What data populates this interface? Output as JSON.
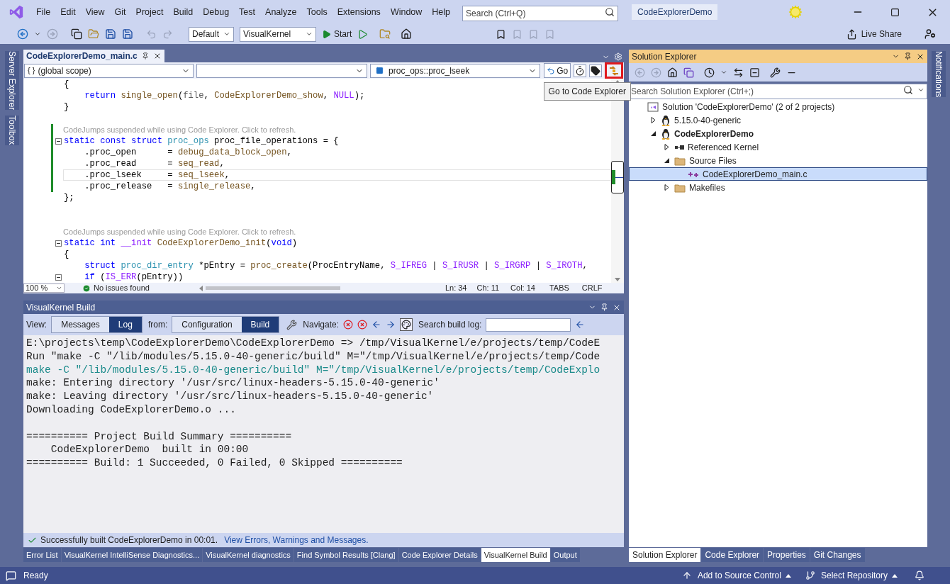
{
  "title_bar": {
    "menus": [
      "File",
      "Edit",
      "View",
      "Git",
      "Project",
      "Build",
      "Debug",
      "Test",
      "Analyze",
      "Tools",
      "Extensions",
      "Window",
      "Help"
    ],
    "search": {
      "placeholder": "Search (Ctrl+Q)"
    },
    "solution_name": "CodeExplorerDemo"
  },
  "toolbar": {
    "configuration": "Default",
    "platform": "VisualKernel",
    "start": "Start",
    "live_share": "Live Share"
  },
  "side_tabs_left": [
    "Server Explorer",
    "Toolbox"
  ],
  "side_tabs_right": [
    "Notifications"
  ],
  "editor": {
    "tab": "CodeExplorerDemo_main.c",
    "scope_glyph": "{ }",
    "scope": "(global scope)",
    "member": "proc_ops::proc_lseek",
    "go": "Go",
    "code_explorer_highlighted": true,
    "tooltip": "Go to Code Explorer",
    "lines": [
      {
        "kind": "code",
        "changed": false,
        "current": false,
        "fold": false,
        "indented": false,
        "tokens": [
          {
            "kind": "plain",
            "text": "{"
          }
        ]
      },
      {
        "kind": "code",
        "changed": false,
        "current": false,
        "fold": false,
        "indented": true,
        "tokens": [
          {
            "kind": "kw",
            "text": "return "
          },
          {
            "kind": "func",
            "text": "single_open"
          },
          {
            "kind": "plain",
            "text": "("
          },
          {
            "kind": "param",
            "text": "file"
          },
          {
            "kind": "plain",
            "text": ", "
          },
          {
            "kind": "func",
            "text": "CodeExplorerDemo_show"
          },
          {
            "kind": "plain",
            "text": ", "
          },
          {
            "kind": "macro",
            "text": "NULL"
          },
          {
            "kind": "plain",
            "text": ");"
          }
        ]
      },
      {
        "kind": "code",
        "changed": false,
        "current": false,
        "fold": false,
        "indented": false,
        "tokens": [
          {
            "kind": "plain",
            "text": "}"
          }
        ]
      },
      {
        "kind": "blank",
        "changed": false
      },
      {
        "kind": "hint",
        "changed": true,
        "text": "CodeJumps suspended while using Code Explorer. Click to refresh."
      },
      {
        "kind": "code",
        "changed": true,
        "current": false,
        "fold": true,
        "indented": false,
        "tokens": [
          {
            "kind": "kw",
            "text": "static const struct "
          },
          {
            "kind": "type",
            "text": "proc_ops"
          },
          {
            "kind": "plain",
            "text": " proc_file_operations = {"
          }
        ]
      },
      {
        "kind": "code",
        "changed": true,
        "current": false,
        "fold": false,
        "indented": true,
        "tokens": [
          {
            "kind": "plain",
            "text": ".proc_open      = "
          },
          {
            "kind": "func",
            "text": "debug_data_block_open"
          },
          {
            "kind": "plain",
            "text": ","
          }
        ]
      },
      {
        "kind": "code",
        "changed": true,
        "current": false,
        "fold": false,
        "indented": true,
        "tokens": [
          {
            "kind": "plain",
            "text": ".proc_read      = "
          },
          {
            "kind": "func",
            "text": "seq_read"
          },
          {
            "kind": "plain",
            "text": ","
          }
        ]
      },
      {
        "kind": "code",
        "changed": true,
        "current": true,
        "fold": false,
        "indented": true,
        "tokens": [
          {
            "kind": "plain",
            "text": ".proc_lseek     = "
          },
          {
            "kind": "func",
            "text": "seq_lseek"
          },
          {
            "kind": "plain",
            "text": ","
          }
        ]
      },
      {
        "kind": "code",
        "changed": true,
        "current": false,
        "fold": false,
        "indented": true,
        "tokens": [
          {
            "kind": "plain",
            "text": ".proc_release   = "
          },
          {
            "kind": "func",
            "text": "single_release"
          },
          {
            "kind": "plain",
            "text": ","
          }
        ]
      },
      {
        "kind": "code",
        "changed": false,
        "current": false,
        "fold": false,
        "indented": false,
        "tokens": [
          {
            "kind": "plain",
            "text": "};"
          }
        ]
      },
      {
        "kind": "blank",
        "changed": false
      },
      {
        "kind": "blank",
        "changed": false
      },
      {
        "kind": "hint",
        "changed": false,
        "text": "CodeJumps suspended while using Code Explorer. Click to refresh."
      },
      {
        "kind": "code",
        "changed": false,
        "current": false,
        "fold": true,
        "indented": false,
        "tokens": [
          {
            "kind": "kw",
            "text": "static int "
          },
          {
            "kind": "macro",
            "text": "__init "
          },
          {
            "kind": "func",
            "text": "CodeExplorerDemo_init"
          },
          {
            "kind": "plain",
            "text": "("
          },
          {
            "kind": "kw",
            "text": "void"
          },
          {
            "kind": "plain",
            "text": ")"
          }
        ]
      },
      {
        "kind": "code",
        "changed": false,
        "current": false,
        "fold": false,
        "indented": false,
        "tokens": [
          {
            "kind": "plain",
            "text": "{"
          }
        ]
      },
      {
        "kind": "code",
        "changed": false,
        "current": false,
        "fold": false,
        "indented": true,
        "tokens": [
          {
            "kind": "kw",
            "text": "struct "
          },
          {
            "kind": "type",
            "text": "proc_dir_entry"
          },
          {
            "kind": "plain",
            "text": " *pEntry = "
          },
          {
            "kind": "func",
            "text": "proc_create"
          },
          {
            "kind": "plain",
            "text": "(ProcEntryName, "
          },
          {
            "kind": "macro",
            "text": "S_IFREG"
          },
          {
            "kind": "plain",
            "text": " | "
          },
          {
            "kind": "macro",
            "text": "S_IRUSR"
          },
          {
            "kind": "plain",
            "text": " | "
          },
          {
            "kind": "macro",
            "text": "S_IRGRP"
          },
          {
            "kind": "plain",
            "text": " | "
          },
          {
            "kind": "macro",
            "text": "S_IROTH"
          },
          {
            "kind": "plain",
            "text": ","
          }
        ]
      },
      {
        "kind": "code",
        "changed": false,
        "current": false,
        "fold": true,
        "indented": true,
        "tokens": [
          {
            "kind": "kw",
            "text": "if"
          },
          {
            "kind": "plain",
            "text": " ("
          },
          {
            "kind": "macro",
            "text": "IS_ERR"
          },
          {
            "kind": "plain",
            "text": "(pEntry))"
          }
        ]
      }
    ],
    "status": {
      "zoom": "100 %",
      "issues": "No issues found",
      "ln": "Ln: 34",
      "ch": "Ch: 11",
      "col": "Col: 14",
      "indent": "TABS",
      "eol": "CRLF"
    }
  },
  "build_panel": {
    "title": "VisualKernel Build",
    "view_label": "View:",
    "views": [
      {
        "label": "Messages",
        "selected": false
      },
      {
        "label": "Log",
        "selected": true
      }
    ],
    "from_label": "from:",
    "sources": [
      {
        "label": "Configuration",
        "selected": false
      },
      {
        "label": "Build",
        "selected": true
      }
    ],
    "navigate_label": "Navigate:",
    "search_label": "Search build log:",
    "log": [
      {
        "kind": "output",
        "text": "E:\\projects\\temp\\CodeExplorerDemo\\CodeExplorerDemo => /tmp/VisualKernel/e/projects/temp/CodeE"
      },
      {
        "kind": "output",
        "text": "Run \"make -C \"/lib/modules/5.15.0-40-generic/build\" M=\"/tmp/VisualKernel/e/projects/temp/Code"
      },
      {
        "kind": "command",
        "text": "make -C \"/lib/modules/5.15.0-40-generic/build\" M=\"/tmp/VisualKernel/e/projects/temp/CodeExplo"
      },
      {
        "kind": "output",
        "text": "make: Entering directory '/usr/src/linux-headers-5.15.0-40-generic'"
      },
      {
        "kind": "output",
        "text": "make: Leaving directory '/usr/src/linux-headers-5.15.0-40-generic'"
      },
      {
        "kind": "output",
        "text": "Downloading CodeExplorerDemo.o ..."
      },
      {
        "kind": "blank"
      },
      {
        "kind": "output",
        "text": "========== Project Build Summary =========="
      },
      {
        "kind": "output",
        "text": "    CodeExplorerDemo  built in 00:00"
      },
      {
        "kind": "output",
        "text": "========== Build: 1 Succeeded, 0 Failed, 0 Skipped =========="
      }
    ],
    "result": "Successfully built CodeExplorerDemo in 00:01.",
    "result_link": "View Errors, Warnings and Messages.",
    "tabs": [
      {
        "label": "Error List",
        "selected": false
      },
      {
        "label": "VisualKernel IntelliSense Diagnostics...",
        "selected": false
      },
      {
        "label": "VisualKernel diagnostics",
        "selected": false
      },
      {
        "label": "Find Symbol Results [Clang]",
        "selected": false
      },
      {
        "label": "Code Explorer Details",
        "selected": false
      },
      {
        "label": "VisualKernel Build",
        "selected": true
      },
      {
        "label": "Output",
        "selected": false
      }
    ]
  },
  "solution_explorer": {
    "title": "Solution Explorer",
    "search": {
      "placeholder": "Search Solution Explorer (Ctrl+;)"
    },
    "tree": [
      {
        "label": "Solution 'CodeExplorerDemo' (2 of 2 projects)",
        "kind": "solution",
        "selected": false,
        "bold": false,
        "children": [
          {
            "label": "5.15.0-40-generic",
            "kind": "project",
            "selected": false,
            "bold": false,
            "expanded": false
          },
          {
            "label": "CodeExplorerDemo",
            "kind": "project",
            "selected": false,
            "bold": true,
            "expanded": true,
            "children": [
              {
                "label": "Referenced Kernel",
                "kind": "reference",
                "selected": false,
                "bold": false,
                "expanded": false
              },
              {
                "label": "Source Files",
                "kind": "folder",
                "selected": false,
                "bold": false,
                "expanded": true,
                "children": [
                  {
                    "label": "CodeExplorerDemo_main.c",
                    "kind": "file",
                    "selected": true,
                    "bold": false
                  }
                ]
              },
              {
                "label": "Makefiles",
                "kind": "folder",
                "selected": false,
                "bold": false,
                "expanded": false
              }
            ]
          }
        ]
      }
    ],
    "tabs": [
      {
        "label": "Solution Explorer",
        "selected": true
      },
      {
        "label": "Code Explorer",
        "selected": false
      },
      {
        "label": "Properties",
        "selected": false
      },
      {
        "label": "Git Changes",
        "selected": false
      }
    ]
  },
  "status_bar": {
    "ready": "Ready",
    "source_control": "Add to Source Control",
    "repository": "Select Repository"
  }
}
